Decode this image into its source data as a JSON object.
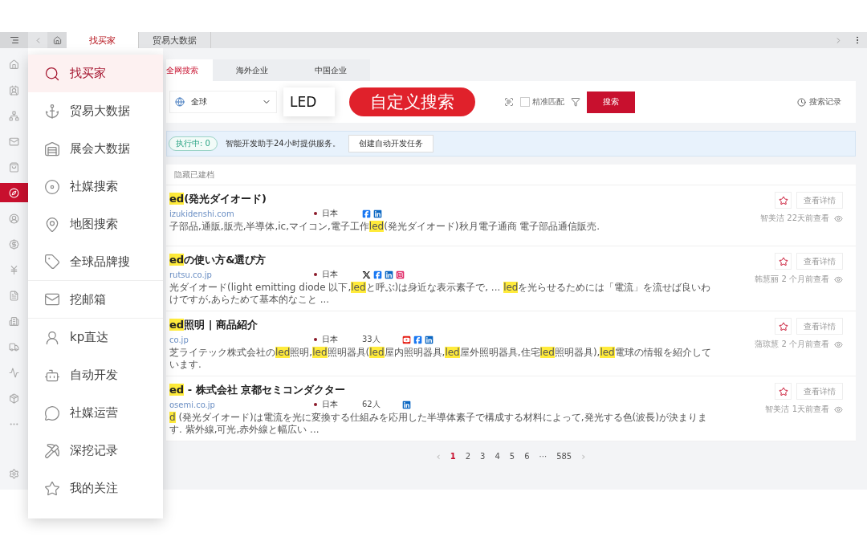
{
  "tab_bar": {
    "tabs": [
      {
        "label": "找买家",
        "selected": true
      },
      {
        "label": "贸易大数据",
        "selected": false
      }
    ]
  },
  "rail": {
    "items": [
      {
        "selected": false
      },
      {
        "selected": false
      },
      {
        "selected": false
      },
      {
        "selected": false
      },
      {
        "selected": false
      },
      {
        "selected": true
      },
      {
        "selected": false
      },
      {
        "selected": false
      },
      {
        "selected": false
      },
      {
        "selected": false
      },
      {
        "selected": false
      },
      {
        "selected": false
      },
      {
        "selected": false
      },
      {
        "selected": false
      },
      {
        "selected": false
      },
      {
        "selected": false
      }
    ]
  },
  "menu": {
    "items": [
      {
        "label": "找买家",
        "selected": true,
        "divider_after": false
      },
      {
        "label": "贸易大数据",
        "selected": false,
        "divider_after": false
      },
      {
        "label": "展会大数据",
        "selected": false,
        "divider_after": false
      },
      {
        "label": "社媒搜索",
        "selected": false,
        "divider_after": false
      },
      {
        "label": "地图搜索",
        "selected": false,
        "divider_after": false
      },
      {
        "label": "全球品牌搜",
        "selected": false,
        "divider_after": true
      },
      {
        "label": "挖邮箱",
        "selected": false,
        "divider_after": true
      },
      {
        "label": "kp直达",
        "selected": false,
        "divider_after": false
      },
      {
        "label": "自动开发",
        "selected": false,
        "divider_after": false
      },
      {
        "label": "社媒运营",
        "selected": false,
        "divider_after": false
      },
      {
        "label": "深挖记录",
        "selected": false,
        "divider_after": false
      },
      {
        "label": "我的关注",
        "selected": false,
        "divider_after": false
      }
    ]
  },
  "search_tabs": [
    {
      "label": "全网搜索",
      "selected": true
    },
    {
      "label": "海外企业",
      "selected": false
    },
    {
      "label": "中国企业",
      "selected": false
    }
  ],
  "search": {
    "region": "全球",
    "query": "LED",
    "callout": "自定义搜索",
    "exact_match": {
      "label": "精准匹配",
      "checked": false
    },
    "button": "搜索",
    "history": "搜索记录"
  },
  "banner": {
    "status": "执行中: 0",
    "message": "智能开发助手24小时提供服务。",
    "button": "创建自动开发任务"
  },
  "results": {
    "filter": "隐藏已建档",
    "rows": [
      {
        "title": [
          {
            "text": "ed",
            "highlight": true
          },
          {
            "text": "(発光ダイオード)",
            "highlight": false
          }
        ],
        "domain": "izukidenshi.com",
        "country": "日本",
        "employees": null,
        "socials": [
          {
            "kind": "facebook"
          },
          {
            "kind": "linkedin"
          }
        ],
        "description": [
          {
            "text": "子部品,通販,販売,半導体,ic,マイコン,電子工作",
            "highlight": false
          },
          {
            "text": "led",
            "highlight": true
          },
          {
            "text": "(発光ダイオード)秋月電子通商 電子部品通信販売.",
            "highlight": false
          }
        ],
        "detail_button": "查看详情",
        "viewed": "智美洁 22天前查看"
      },
      {
        "title": [
          {
            "text": "ed",
            "highlight": true
          },
          {
            "text": "の使い方&選び方",
            "highlight": false
          }
        ],
        "domain": "rutsu.co.jp",
        "country": "日本",
        "employees": null,
        "socials": [
          {
            "kind": "x"
          },
          {
            "kind": "facebook"
          },
          {
            "kind": "linkedin"
          },
          {
            "kind": "instagram"
          }
        ],
        "description": [
          {
            "text": "光ダイオード(light emitting diode 以下,",
            "highlight": false
          },
          {
            "text": "led",
            "highlight": true
          },
          {
            "text": "と呼ぶ)は身近な表示素子で, ... ",
            "highlight": false
          },
          {
            "text": "led",
            "highlight": true
          },
          {
            "text": "を光らせるためには「電流」を流せば良いわけですが,あらためて基本的なこと ...",
            "highlight": false
          }
        ],
        "detail_button": "查看详情",
        "viewed": "韩慧丽 2 个月前查看"
      },
      {
        "title": [
          {
            "text": "ed",
            "highlight": true
          },
          {
            "text": "照明 | 商品紹介",
            "highlight": false
          }
        ],
        "domain": "co.jp",
        "country": "日本",
        "employees": "33人",
        "socials": [
          {
            "kind": "youtube"
          },
          {
            "kind": "facebook"
          },
          {
            "kind": "linkedin"
          }
        ],
        "description": [
          {
            "text": "芝ライテック株式会社の",
            "highlight": false
          },
          {
            "text": "led",
            "highlight": true
          },
          {
            "text": "照明,",
            "highlight": false
          },
          {
            "text": "led",
            "highlight": true
          },
          {
            "text": "照明器具(",
            "highlight": false
          },
          {
            "text": "led",
            "highlight": true
          },
          {
            "text": "屋内照明器具,",
            "highlight": false
          },
          {
            "text": "led",
            "highlight": true
          },
          {
            "text": "屋外照明器具,住宅",
            "highlight": false
          },
          {
            "text": "led",
            "highlight": true
          },
          {
            "text": "照明器具),",
            "highlight": false
          },
          {
            "text": "led",
            "highlight": true
          },
          {
            "text": "電球の情報を紹介しています.",
            "highlight": false
          }
        ],
        "detail_button": "查看详情",
        "viewed": "蒲琼慧 2 个月前查看"
      },
      {
        "title": [
          {
            "text": "ed",
            "highlight": true
          },
          {
            "text": " - 株式会社 京都セミコンダクター",
            "highlight": false
          }
        ],
        "domain": "osemi.co.jp",
        "country": "日本",
        "employees": "62人",
        "socials": [
          {
            "kind": "linkedin"
          }
        ],
        "description": [
          {
            "text": "d",
            "highlight": true
          },
          {
            "text": " (発光ダイオード)は電流を光に変換する仕組みを応用した半導体素子で構成する材料によって,発光する色(波長)が決まります. 紫外線,可光,赤外線と幅広い ...",
            "highlight": false
          }
        ],
        "detail_button": "查看详情",
        "viewed": "智美洁 1天前查看"
      }
    ]
  },
  "pagination": {
    "prev": "‹",
    "pages": [
      {
        "label": "1",
        "selected": true
      },
      {
        "label": "2",
        "selected": false
      },
      {
        "label": "3",
        "selected": false
      },
      {
        "label": "4",
        "selected": false
      },
      {
        "label": "5",
        "selected": false
      },
      {
        "label": "6",
        "selected": false
      },
      {
        "label": "···",
        "selected": false
      },
      {
        "label": "585",
        "selected": false
      }
    ],
    "next": "›"
  }
}
